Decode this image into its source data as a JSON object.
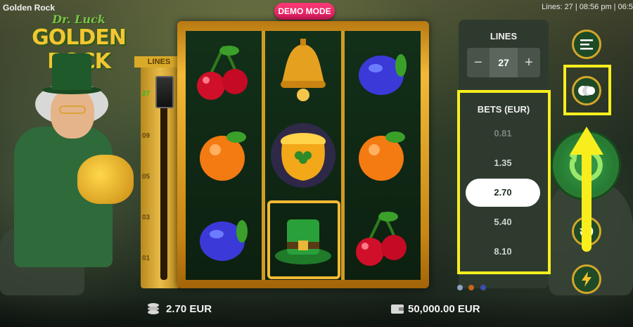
{
  "header": {
    "app_title": "Golden Rock",
    "status": "Lines: 27 | 08:56 pm | 06:5",
    "demo_label": "DEMO MODE"
  },
  "logo": {
    "top": "Dr. Luck",
    "main": "GOLDEN ROCK"
  },
  "reels": {
    "columns": [
      [
        "cherry-icon",
        "orange-icon",
        "plum-icon"
      ],
      [
        "bell-icon",
        "pot-of-gold-icon",
        "leprechaun-hat-icon"
      ],
      [
        "plum-icon",
        "orange-icon",
        "cherry-icon"
      ]
    ]
  },
  "lines_slider": {
    "header": "LINES",
    "current": "27",
    "ticks": [
      "27",
      "09",
      "05",
      "03",
      "01"
    ]
  },
  "settings": {
    "lines_title": "LINES",
    "lines_value": "27",
    "minus": "−",
    "plus": "+",
    "bets_title": "BETS (EUR)",
    "bet_options": [
      "0.81",
      "1.35",
      "2.70",
      "5.40",
      "8.10"
    ],
    "selected_bet": "2.70"
  },
  "footer": {
    "bet": "2.70 EUR",
    "balance": "50,000.00 EUR"
  },
  "colors": {
    "accent_gold": "#f2b936",
    "highlight_yellow": "#f8ee1e",
    "demo_pink": "#e81f63",
    "panel": "#2f3a2f"
  }
}
